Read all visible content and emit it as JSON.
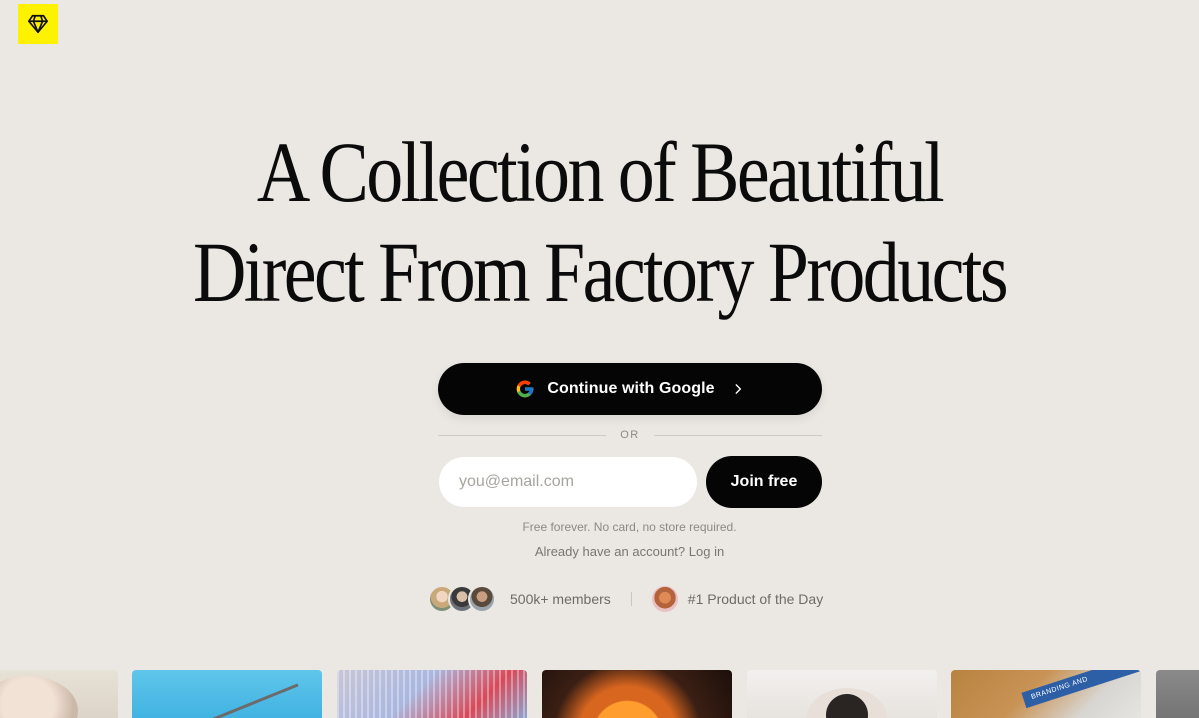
{
  "brand": {
    "logo_icon": "diamond-icon",
    "logo_color": "#fff200"
  },
  "hero": {
    "headline_line1": "A Collection of Beautiful",
    "headline_line2": "Direct From Factory Products"
  },
  "auth": {
    "google_button_label": "Continue with Google",
    "divider_text": "OR",
    "email_placeholder": "you@email.com",
    "email_value": "",
    "join_button_label": "Join free",
    "fine_print": "Free forever. No card, no store required.",
    "login_prompt": "Already have an account?",
    "login_link": "Log in"
  },
  "social_proof": {
    "members_text": "500k+ members",
    "award_text": "#1 Product of the Day"
  },
  "product_strip": {
    "tiles": [
      {
        "name": "product-tile-portrait"
      },
      {
        "name": "product-tile-antenna"
      },
      {
        "name": "product-tile-cassette"
      },
      {
        "name": "product-tile-sunset-lamp"
      },
      {
        "name": "product-tile-person"
      },
      {
        "name": "product-tile-packaging"
      },
      {
        "name": "product-tile-gray"
      }
    ],
    "packaging_text": "BRANDING AND"
  },
  "colors": {
    "background": "#ebe8e3",
    "button_bg": "#050505",
    "button_text": "#ffffff"
  }
}
